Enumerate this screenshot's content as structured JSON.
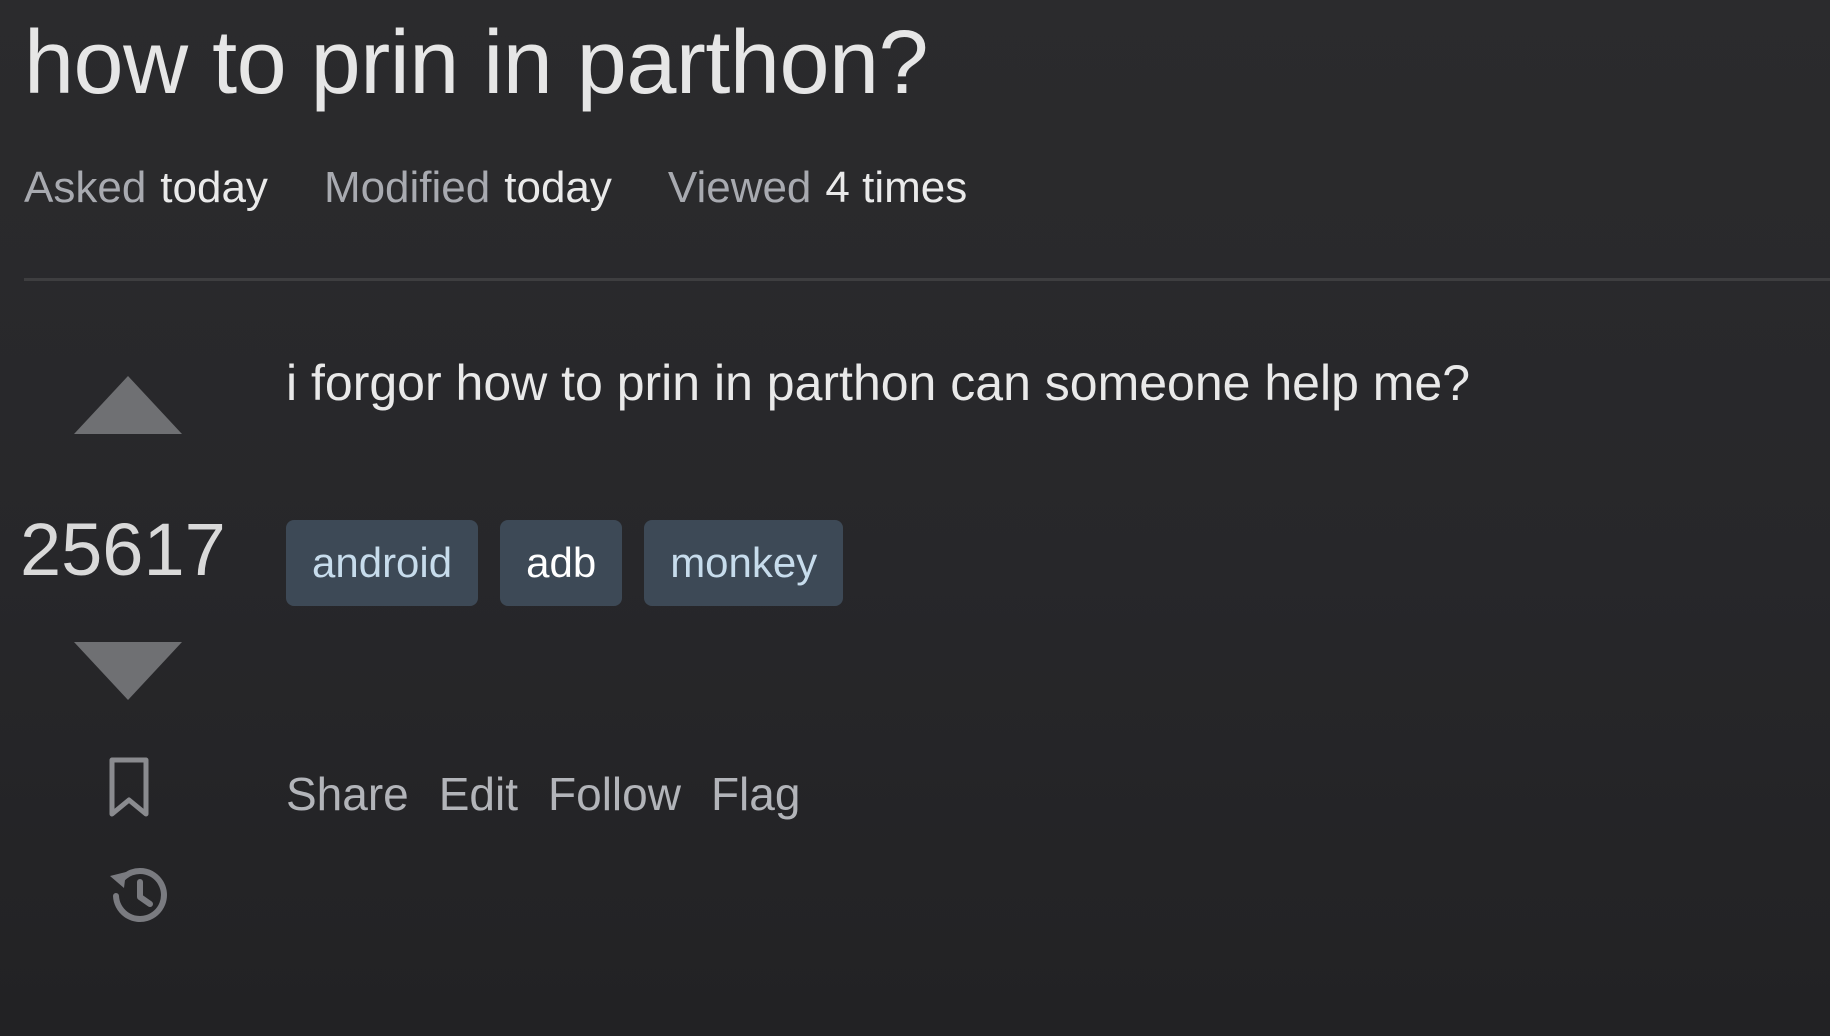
{
  "question": {
    "title": "how to prin in parthon?",
    "meta": {
      "asked_label": "Asked",
      "asked_value": "today",
      "modified_label": "Modified",
      "modified_value": "today",
      "viewed_label": "Viewed",
      "viewed_value": "4 times"
    },
    "vote_count": "25617",
    "body": "i forgor how to prin in parthon can someone help me?",
    "tags": [
      "android",
      "adb",
      "monkey"
    ],
    "actions": {
      "share": "Share",
      "edit": "Edit",
      "follow": "Follow",
      "flag": "Flag"
    }
  },
  "icons": {
    "upvote": "upvote-icon",
    "downvote": "downvote-icon",
    "bookmark": "bookmark-icon",
    "history": "history-icon"
  },
  "colors": {
    "background": "#2b2b2d",
    "tag_background": "#3d4956",
    "tag_text": "#c7dcec",
    "vote_arrow": "#6f7073",
    "muted_text": "#a8aab0"
  }
}
